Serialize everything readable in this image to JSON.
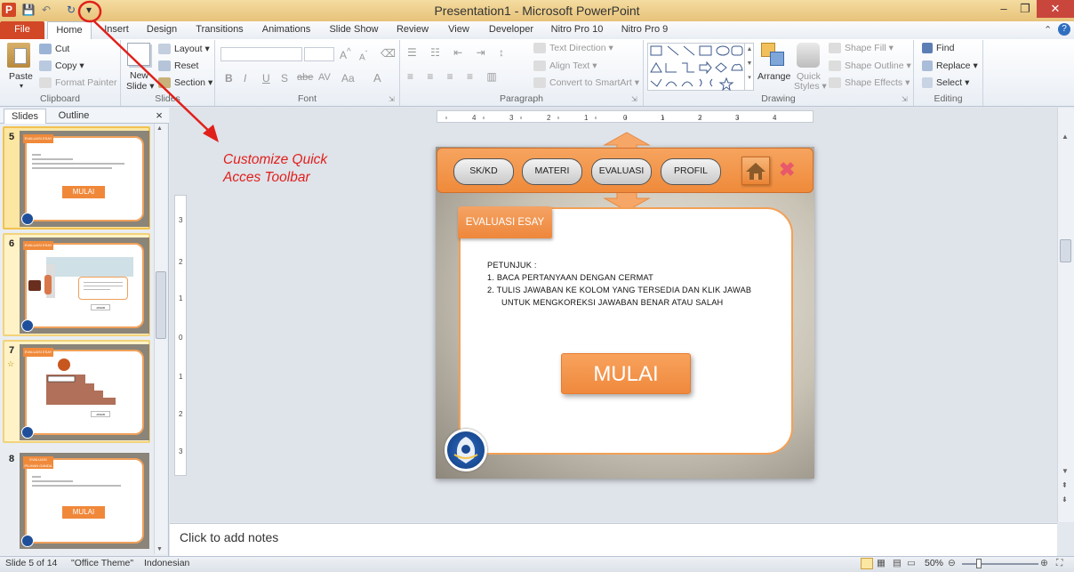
{
  "window": {
    "title": "Presentation1 - Microsoft PowerPoint",
    "controls": {
      "minimize": "–",
      "maximize": "❐",
      "close": "✕"
    }
  },
  "qat": {
    "app_icon": "P",
    "save": "💾",
    "undo": "↶",
    "redo": "↻",
    "customize": "▾"
  },
  "tabs": [
    "File",
    "Home",
    "Insert",
    "Design",
    "Transitions",
    "Animations",
    "Slide Show",
    "Review",
    "View",
    "Developer",
    "Nitro Pro 10",
    "Nitro Pro 9"
  ],
  "ribbon": {
    "clipboard": {
      "label": "Clipboard",
      "paste": "Paste",
      "cut": "Cut",
      "copy": "Copy",
      "format_painter": "Format Painter"
    },
    "slides": {
      "label": "Slides",
      "new_slide": "New",
      "new_slide2": "Slide",
      "layout": "Layout",
      "reset": "Reset",
      "section": "Section"
    },
    "font": {
      "label": "Font",
      "buttons": [
        "B",
        "I",
        "U",
        "S",
        "abe",
        "AV",
        "Aa",
        "A"
      ]
    },
    "paragraph": {
      "label": "Paragraph",
      "text_direction": "Text Direction",
      "align_text": "Align Text",
      "convert_smartart": "Convert to SmartArt"
    },
    "drawing": {
      "label": "Drawing",
      "arrange": "Arrange",
      "quick_styles": "Quick",
      "quick_styles2": "Styles",
      "shape_fill": "Shape Fill",
      "shape_outline": "Shape Outline",
      "shape_effects": "Shape Effects"
    },
    "editing": {
      "label": "Editing",
      "find": "Find",
      "replace": "Replace",
      "select": "Select"
    }
  },
  "pane": {
    "tab_slides": "Slides",
    "tab_outline": "Outline",
    "close": "×"
  },
  "thumbs": [
    {
      "num": "5",
      "tag": "EVALUASI ESAY",
      "button": "MULAI"
    },
    {
      "num": "6",
      "tag": "EVALUASI ESAY",
      "button": "JAWAB"
    },
    {
      "num": "7",
      "tag": "EVALUASI ESAY",
      "button": "JAWAB"
    },
    {
      "num": "8",
      "tag": "EVALUASI PILIHAN GANDA",
      "button": "MULAI"
    }
  ],
  "slide": {
    "nav": [
      "SK/KD",
      "MATERI",
      "EVALUASI",
      "PROFIL"
    ],
    "tag": "EVALUASI ESAY",
    "instructions_title": "PETUNJUK  :",
    "line1": "1.   BACA  PERTANYAAN   DENGAN  CERMAT",
    "line2": "2.   TULIS JAWABAN  KE KOLOM YANG TERSEDIA DAN KLIK JAWAB",
    "line3": "UNTUK  MENGKOREKSI  JAWABAN  BENAR ATAU  SALAH",
    "button": "MULAI"
  },
  "annotation": {
    "line1": "Customize Quick",
    "line2": "Acces Toolbar"
  },
  "notes": {
    "placeholder": "Click to add notes"
  },
  "status": {
    "slide": "Slide 5 of 14",
    "theme": "\"Office Theme\"",
    "language": "Indonesian",
    "zoom": "50%"
  },
  "colors": {
    "accent": "#ef8a3a",
    "file_tab": "#d24726",
    "annotation": "#e0201b"
  }
}
